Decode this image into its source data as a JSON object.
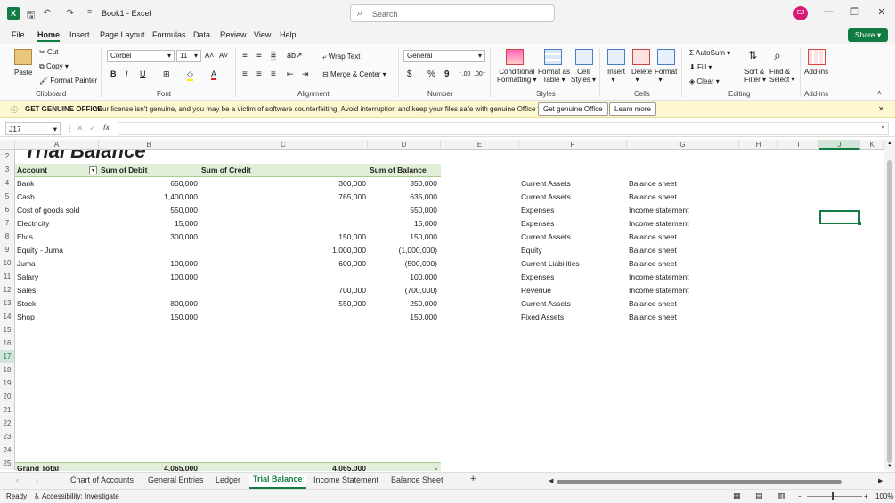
{
  "window": {
    "title": "Book1 - Excel",
    "avatar": "EJ"
  },
  "search": {
    "placeholder": "Search"
  },
  "menu": [
    "File",
    "Home",
    "Insert",
    "Page Layout",
    "Formulas",
    "Data",
    "Review",
    "View",
    "Help"
  ],
  "share_label": "Share",
  "ribbon": {
    "clipboard": {
      "paste": "Paste",
      "cut": "Cut",
      "copy": "Copy",
      "format_painter": "Format Painter",
      "label": "Clipboard"
    },
    "font": {
      "name": "Corbel",
      "size": "11",
      "label": "Font"
    },
    "alignment": {
      "wrap": "Wrap Text",
      "merge": "Merge & Center",
      "label": "Alignment"
    },
    "number": {
      "format": "General",
      "currency": "$",
      "percent": "%",
      "comma": "9",
      "label": "Number"
    },
    "styles": {
      "conditional": "Conditional",
      "conditional2": "Formatting",
      "format_table": "Format as",
      "format_table2": "Table",
      "cell_styles": "Cell",
      "cell_styles2": "Styles",
      "label": "Styles"
    },
    "cells": {
      "insert": "Insert",
      "delete": "Delete",
      "format": "Format",
      "label": "Cells"
    },
    "editing": {
      "autosum": "AutoSum",
      "fill": "Fill",
      "clear": "Clear",
      "sort": "Sort &",
      "sort2": "Filter",
      "find": "Find &",
      "find2": "Select",
      "label": "Editing"
    },
    "addins": {
      "addins": "Add-ins",
      "label": "Add-ins"
    }
  },
  "banner": {
    "title": "GET GENUINE OFFICE",
    "message": "Your license isn't genuine, and you may be a victim of software counterfeiting. Avoid interruption and keep your files safe with genuine Office today.",
    "btn1": "Get genuine Office",
    "btn2": "Learn more"
  },
  "namebox": "J17",
  "fx": "fx",
  "columns": [
    "A",
    "B",
    "C",
    "D",
    "E",
    "F",
    "G",
    "H",
    "I",
    "J",
    "K"
  ],
  "sheet_title_fragment": "Trial Balance",
  "pivot_headers": {
    "account": "Account",
    "debit": "Sum of Debit",
    "credit": "Sum of Credit",
    "balance": "Sum of Balance"
  },
  "rows": [
    {
      "r": "4",
      "account": "Bank",
      "debit": "650,000",
      "credit": "300,000",
      "balance": "350,000",
      "f": "Current Assets",
      "g": "Balance sheet"
    },
    {
      "r": "5",
      "account": "Cash",
      "debit": "1,400,000",
      "credit": "765,000",
      "balance": "635,000",
      "f": "Current Assets",
      "g": "Balance sheet"
    },
    {
      "r": "6",
      "account": "Cost of goods sold",
      "debit": "550,000",
      "credit": "",
      "balance": "550,000",
      "f": "Expenses",
      "g": "Income statement"
    },
    {
      "r": "7",
      "account": "Electricity",
      "debit": "15,000",
      "credit": "",
      "balance": "15,000",
      "f": "Expenses",
      "g": "Income statement"
    },
    {
      "r": "8",
      "account": "Elvis",
      "debit": "300,000",
      "credit": "150,000",
      "balance": "150,000",
      "f": "Current Assets",
      "g": "Balance sheet"
    },
    {
      "r": "9",
      "account": "Equity - Juma",
      "debit": "",
      "credit": "1,000,000",
      "balance": "(1,000,000)",
      "f": "Equity",
      "g": "Balance sheet"
    },
    {
      "r": "10",
      "account": "Juma",
      "debit": "100,000",
      "credit": "600,000",
      "balance": "(500,000)",
      "f": "Current Liabilities",
      "g": "Balance sheet"
    },
    {
      "r": "11",
      "account": "Salary",
      "debit": "100,000",
      "credit": "",
      "balance": "100,000",
      "f": "Expenses",
      "g": "Income statement"
    },
    {
      "r": "12",
      "account": "Sales",
      "debit": "",
      "credit": "700,000",
      "balance": "(700,000)",
      "f": "Revenue",
      "g": "Income statement"
    },
    {
      "r": "13",
      "account": "Stock",
      "debit": "800,000",
      "credit": "550,000",
      "balance": "250,000",
      "f": "Current Assets",
      "g": "Balance sheet"
    },
    {
      "r": "14",
      "account": "Shop",
      "debit": "150,000",
      "credit": "",
      "balance": "150,000",
      "f": "Fixed Assets",
      "g": "Balance sheet"
    }
  ],
  "grand_total": {
    "label": "Grand Total",
    "debit": "4,065,000",
    "credit": "4,065,000",
    "balance": "-"
  },
  "row_numbers": [
    "2",
    "3",
    "4",
    "5",
    "6",
    "7",
    "8",
    "9",
    "10",
    "11",
    "12",
    "13",
    "14",
    "15",
    "16",
    "17",
    "18",
    "19",
    "20",
    "21",
    "22",
    "23",
    "24",
    "25"
  ],
  "tabs": [
    "Chart of Accounts",
    "General Entries",
    "Ledger",
    "Trial Balance",
    "Income Statement",
    "Balance Sheet"
  ],
  "active_tab": "Trial Balance",
  "status": {
    "ready": "Ready",
    "accessibility": "Accessibility: Investigate",
    "zoom": "100%"
  },
  "colors": {
    "accent": "#107c41",
    "pivot": "#e1efd9",
    "banner": "#fef8d0"
  }
}
